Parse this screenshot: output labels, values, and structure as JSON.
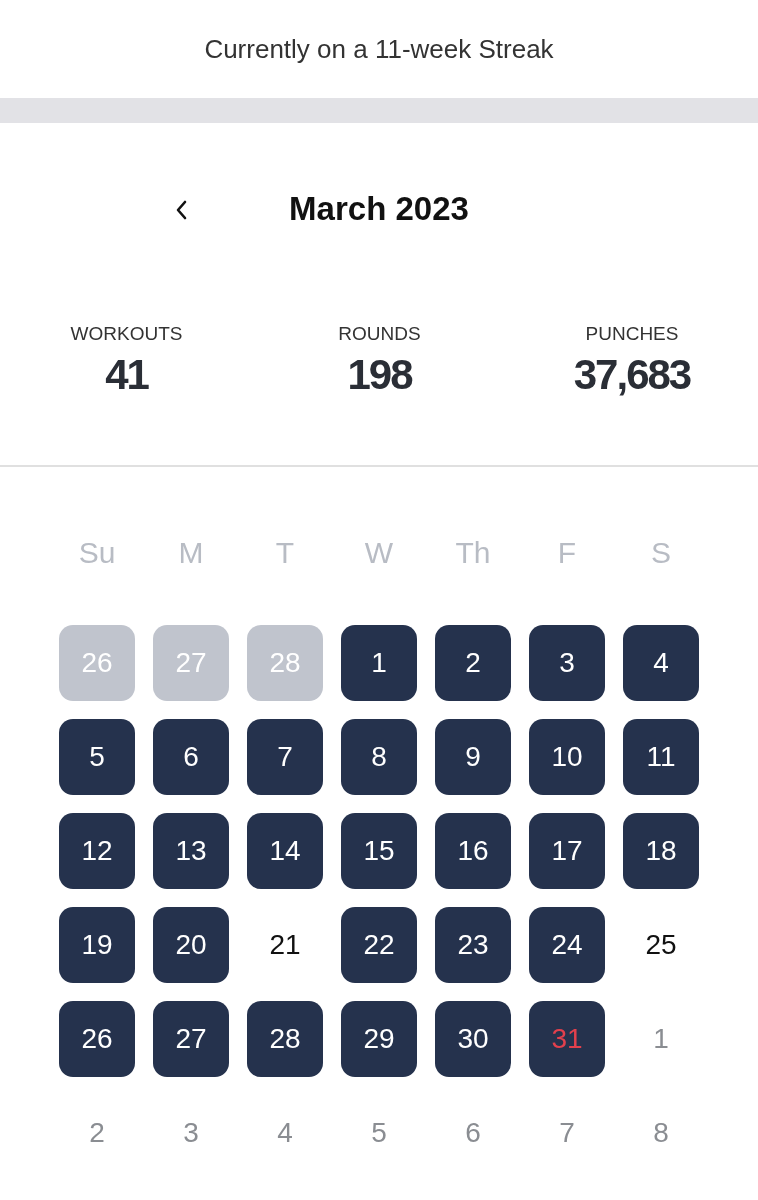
{
  "streak": "Currently on a 11-week Streak",
  "month": {
    "title": "March 2023",
    "prev_icon": true
  },
  "stats": [
    {
      "label": "WORKOUTS",
      "value": "41"
    },
    {
      "label": "ROUNDS",
      "value": "198"
    },
    {
      "label": "PUNCHES",
      "value": "37,683"
    }
  ],
  "weekdays": [
    "Su",
    "M",
    "T",
    "W",
    "Th",
    "F",
    "S"
  ],
  "days": [
    {
      "label": "26",
      "kind": "past_month_workout"
    },
    {
      "label": "27",
      "kind": "past_month_workout"
    },
    {
      "label": "28",
      "kind": "past_month_workout"
    },
    {
      "label": "1",
      "kind": "workout"
    },
    {
      "label": "2",
      "kind": "workout"
    },
    {
      "label": "3",
      "kind": "workout"
    },
    {
      "label": "4",
      "kind": "workout"
    },
    {
      "label": "5",
      "kind": "workout"
    },
    {
      "label": "6",
      "kind": "workout"
    },
    {
      "label": "7",
      "kind": "workout"
    },
    {
      "label": "8",
      "kind": "workout"
    },
    {
      "label": "9",
      "kind": "workout"
    },
    {
      "label": "10",
      "kind": "workout"
    },
    {
      "label": "11",
      "kind": "workout"
    },
    {
      "label": "12",
      "kind": "workout"
    },
    {
      "label": "13",
      "kind": "workout"
    },
    {
      "label": "14",
      "kind": "workout"
    },
    {
      "label": "15",
      "kind": "workout"
    },
    {
      "label": "16",
      "kind": "workout"
    },
    {
      "label": "17",
      "kind": "workout"
    },
    {
      "label": "18",
      "kind": "workout"
    },
    {
      "label": "19",
      "kind": "workout"
    },
    {
      "label": "20",
      "kind": "workout"
    },
    {
      "label": "21",
      "kind": "rest"
    },
    {
      "label": "22",
      "kind": "workout"
    },
    {
      "label": "23",
      "kind": "workout"
    },
    {
      "label": "24",
      "kind": "workout"
    },
    {
      "label": "25",
      "kind": "rest"
    },
    {
      "label": "26",
      "kind": "workout"
    },
    {
      "label": "27",
      "kind": "workout"
    },
    {
      "label": "28",
      "kind": "workout"
    },
    {
      "label": "29",
      "kind": "workout"
    },
    {
      "label": "30",
      "kind": "workout"
    },
    {
      "label": "31",
      "kind": "today_workout"
    },
    {
      "label": "1",
      "kind": "next_month"
    },
    {
      "label": "2",
      "kind": "next_month"
    },
    {
      "label": "3",
      "kind": "next_month"
    },
    {
      "label": "4",
      "kind": "next_month"
    },
    {
      "label": "5",
      "kind": "next_month"
    },
    {
      "label": "6",
      "kind": "next_month"
    },
    {
      "label": "7",
      "kind": "next_month"
    },
    {
      "label": "8",
      "kind": "next_month"
    }
  ]
}
